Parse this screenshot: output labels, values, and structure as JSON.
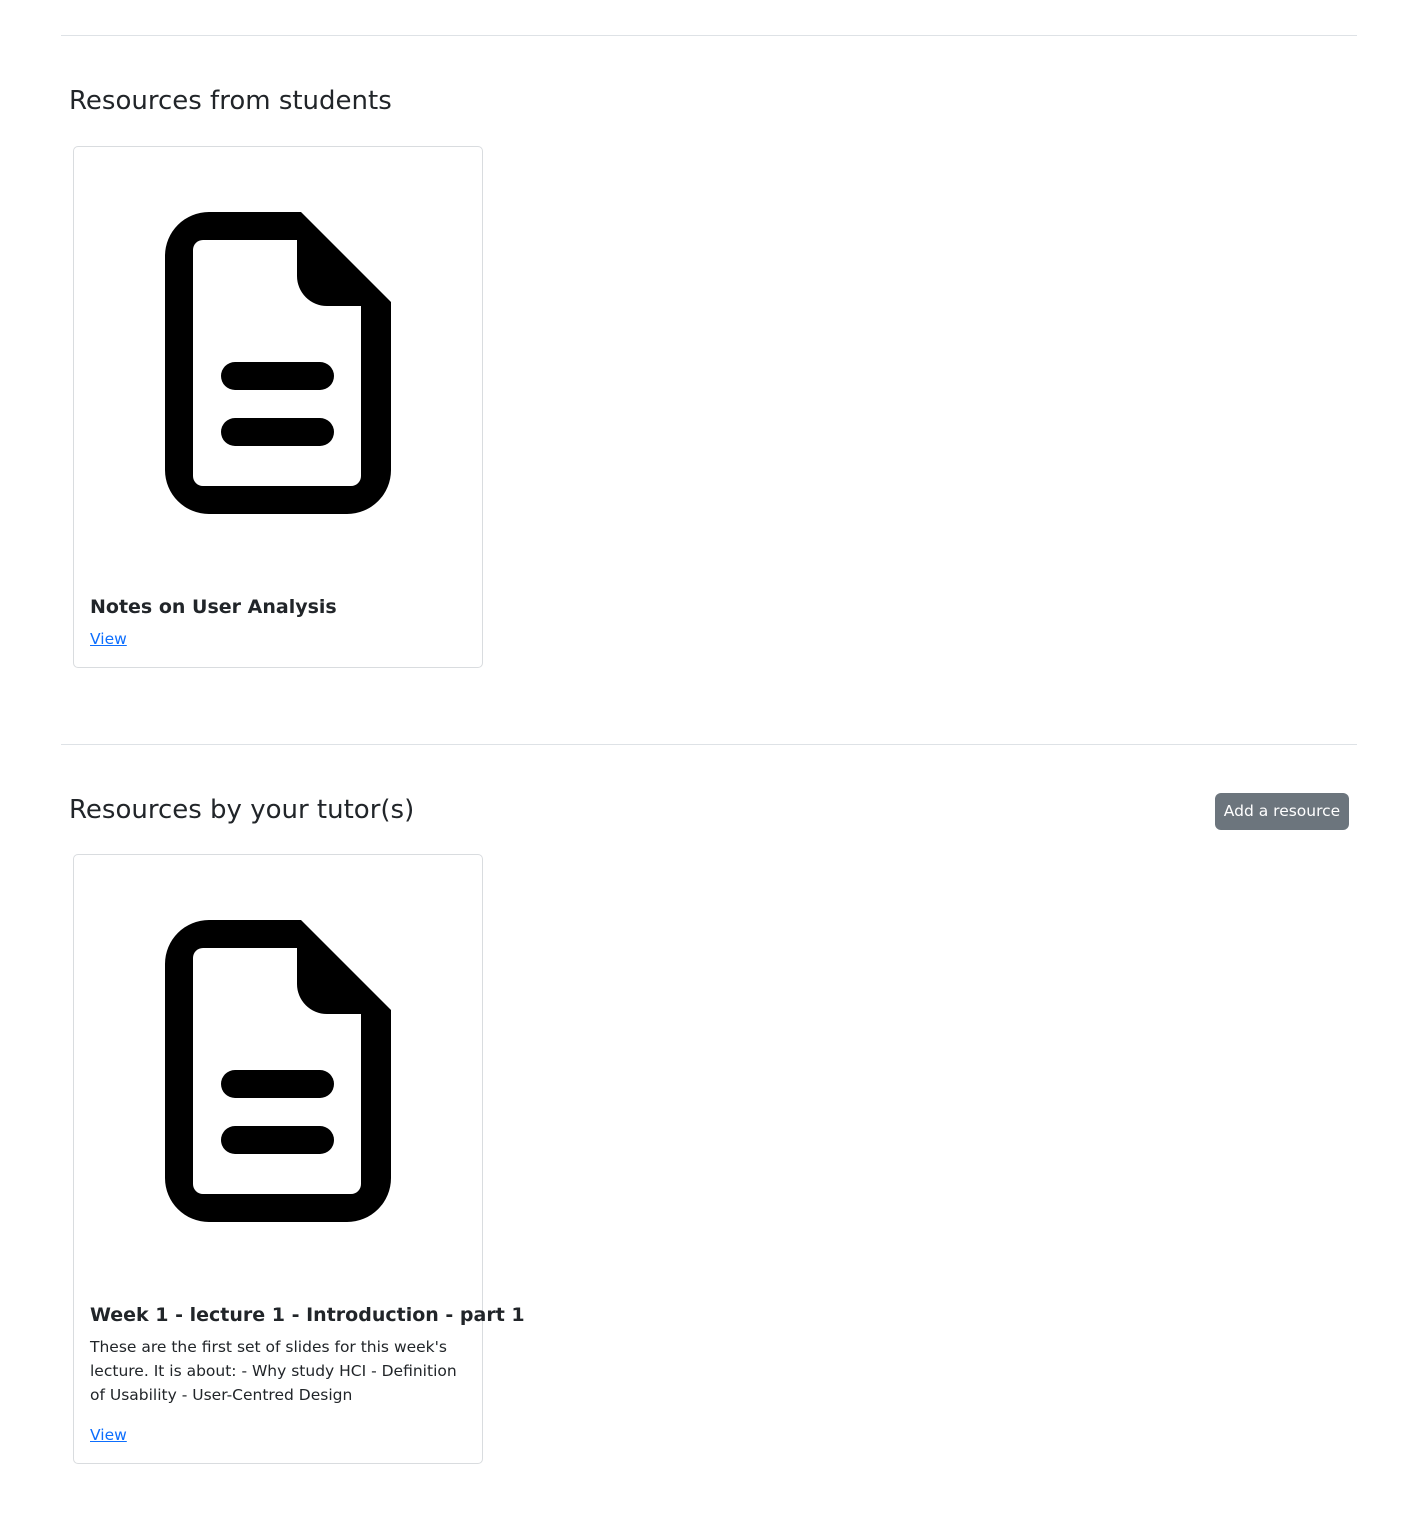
{
  "students_section": {
    "title": "Resources from students",
    "cards": [
      {
        "icon": "file-text-icon",
        "title": "Notes on User Analysis",
        "link_label": "View"
      }
    ]
  },
  "tutor_section": {
    "title": "Resources by your tutor(s)",
    "add_button_label": "Add a resource",
    "cards": [
      {
        "icon": "file-text-icon",
        "title": "Week 1 - lecture 1 - Introduction - part 1",
        "description": "These are the first set of slides for this week's lecture. It is about: - Why study HCI - Definition of Usability - User-Centred Design",
        "link_label": "View"
      }
    ]
  },
  "colors": {
    "button_bg": "#6c757d",
    "link": "#0d6efd",
    "border": "#dee2e6"
  }
}
